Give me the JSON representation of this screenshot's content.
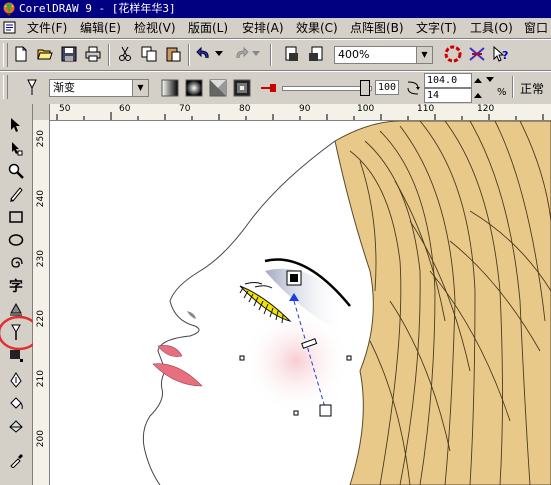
{
  "window": {
    "title": "CorelDRAW 9 - [花样年华3]"
  },
  "menubar": {
    "items": [
      "文件(F)",
      "编辑(E)",
      "检视(V)",
      "版面(L)",
      "安排(A)",
      "效果(C)",
      "点阵图(B)",
      "文字(T)",
      "工具(O)",
      "窗口"
    ]
  },
  "standard_toolbar": {
    "zoom_value": "400%"
  },
  "property_bar": {
    "fill_type": "渐变",
    "midpoint_value": "100",
    "angle_value": "104.0",
    "steps_value": "14",
    "percent_label": "%",
    "mode_label": "正常"
  },
  "rulers": {
    "top_labels": [
      "50",
      "60",
      "70",
      "80",
      "90",
      "100",
      "110",
      "120"
    ],
    "left_labels": [
      "250",
      "240",
      "230",
      "220",
      "210",
      "200"
    ]
  },
  "colors": {
    "title_bar": "#000080",
    "hair": "#e8c98a",
    "lips": "#e8707e",
    "eyelash": "#f2e300",
    "interactive_fill_arrow": "#1a3de0",
    "highlight_circle": "#e03030"
  }
}
